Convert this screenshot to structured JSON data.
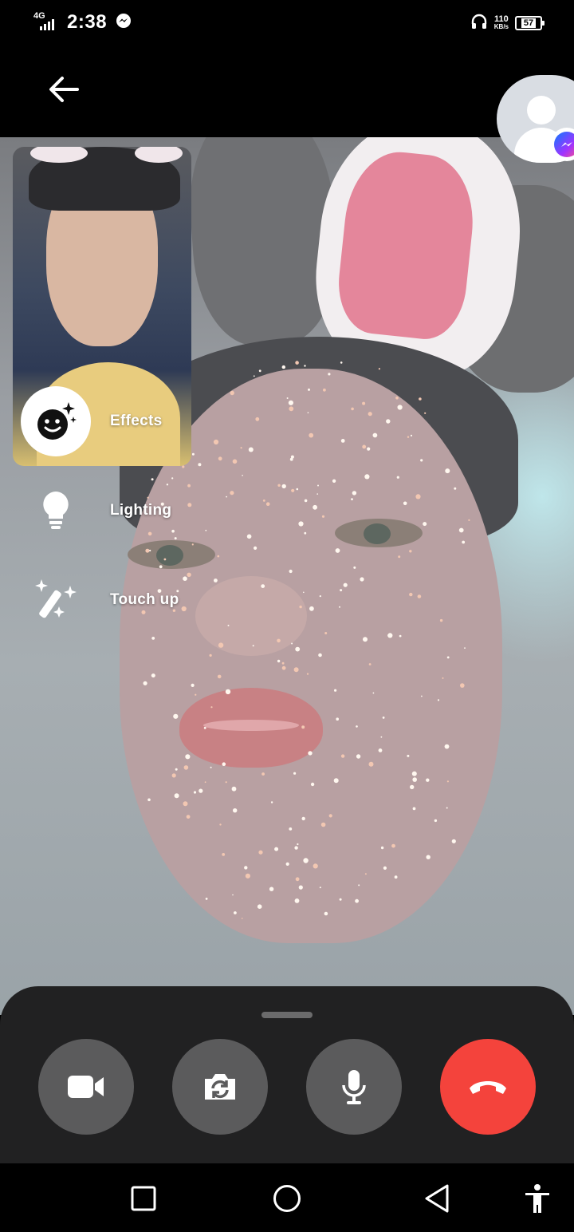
{
  "status_bar": {
    "network": "4G",
    "time": "2:38",
    "speed_value": "110",
    "speed_unit": "KB/s",
    "battery": "57",
    "icons": [
      "signal-icon",
      "messenger-notification-icon",
      "headphones-icon",
      "battery-icon"
    ]
  },
  "top_bar": {
    "back_icon": "arrow-left-icon",
    "avatar_icon": "default-profile-icon",
    "badge_icon": "messenger-icon"
  },
  "effects_menu": {
    "effects_label": "Effects",
    "lighting_label": "Lighting",
    "touch_up_label": "Touch up",
    "icons": [
      "face-sparkle-icon",
      "lightbulb-icon",
      "magic-wand-icon"
    ]
  },
  "call_controls": {
    "buttons": [
      "video-camera-icon",
      "flip-camera-icon",
      "microphone-icon",
      "end-call-icon"
    ],
    "end_call_color": "#f4433c",
    "button_color": "#5b5b5c",
    "sheet_color": "#212122"
  },
  "nav_bar": {
    "buttons": [
      "recents-square-icon",
      "home-circle-icon",
      "back-triangle-icon",
      "accessibility-icon"
    ]
  }
}
